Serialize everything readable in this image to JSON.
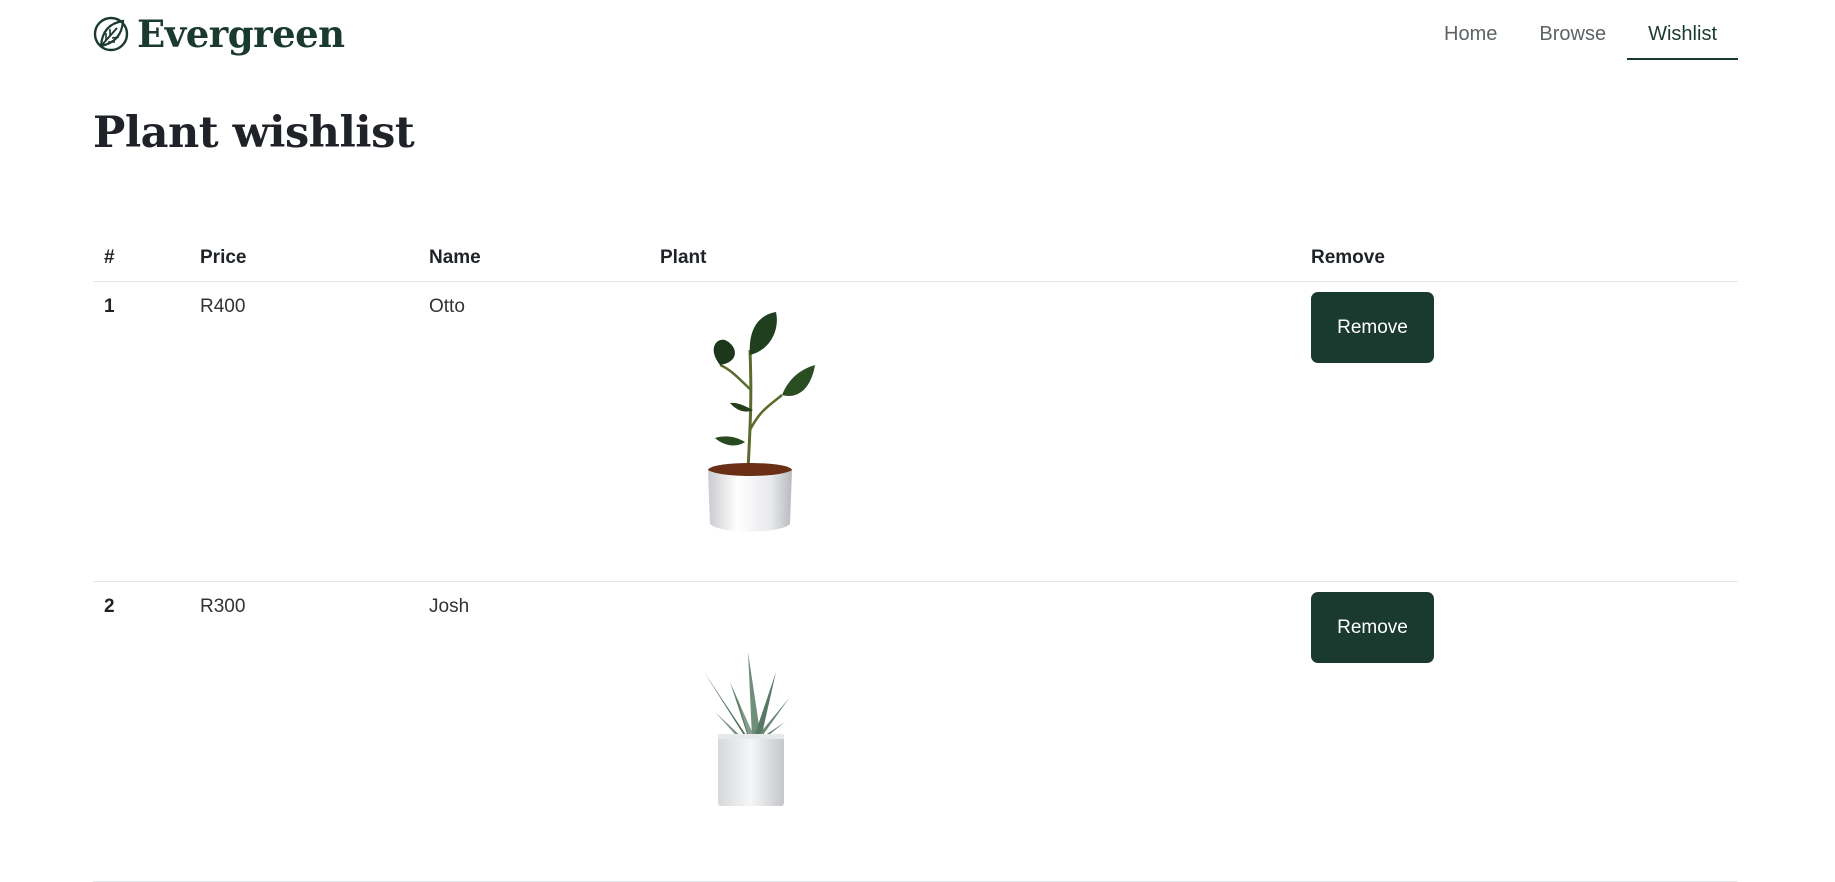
{
  "brand": {
    "name": "Evergreen",
    "icon": "leaf-icon",
    "color": "#1b3a2f"
  },
  "nav": {
    "items": [
      {
        "label": "Home",
        "active": false
      },
      {
        "label": "Browse",
        "active": false
      },
      {
        "label": "Wishlist",
        "active": true
      }
    ]
  },
  "page": {
    "title": "Plant wishlist"
  },
  "table": {
    "headers": [
      "#",
      "Price",
      "Name",
      "Plant",
      "Remove"
    ],
    "rows": [
      {
        "index": "1",
        "price": "R400",
        "name": "Otto",
        "plant_image": "rubber-plant-image",
        "remove_label": "Remove"
      },
      {
        "index": "2",
        "price": "R300",
        "name": "Josh",
        "plant_image": "succulent-plant-image",
        "remove_label": "Remove"
      }
    ]
  }
}
